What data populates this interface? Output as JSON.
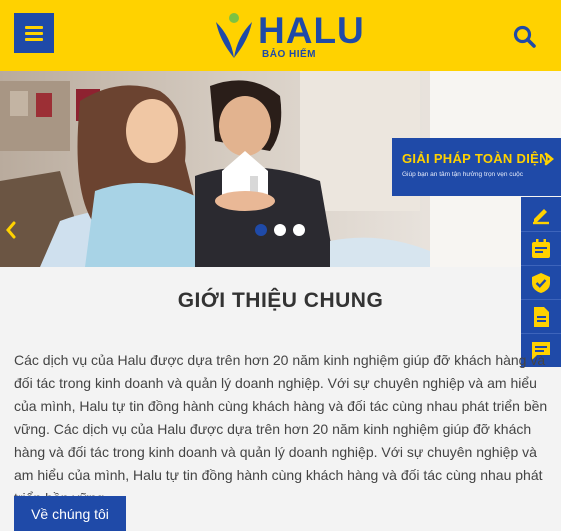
{
  "header": {
    "logo_text": "HALU",
    "logo_sub": "BẢO HIỂM",
    "menu_icon": "hamburger-menu-icon",
    "search_icon": "search-icon",
    "bg_color": "#ffd200",
    "brand_color": "#1f4aa8"
  },
  "hero": {
    "slides_total": 3,
    "active_slide": 1,
    "banner": {
      "title": "GIẢI PHÁP TOÀN DIỆN",
      "subtitle": "Giúp bạn an tâm tận hưởng trọn vẹn cuộc"
    }
  },
  "side_tools": [
    {
      "icon": "edit-document-icon"
    },
    {
      "icon": "calendar-icon"
    },
    {
      "icon": "shield-check-icon"
    },
    {
      "icon": "document-icon"
    },
    {
      "icon": "chat-icon"
    }
  ],
  "intro": {
    "title": "GIỚI THIỆU CHUNG",
    "body": "Các dịch vụ của Halu được dựa trên hơn 20 năm kinh nghiệm giúp đỡ khách hàng và đối tác trong kinh doanh và quản lý doanh nghiệp. Với sự chuyên nghiệp và am hiểu của mình, Halu tự tin đồng hành cùng khách hàng và đối tác cùng nhau phát triển bền vững. Các dịch vụ của Halu được dựa trên hơn 20 năm kinh nghiệm giúp đỡ khách hàng và đối tác trong kinh doanh và quản lý doanh nghiệp. Với sự chuyên nghiệp và am hiểu của mình, Halu tự tin đồng hành cùng khách hàng và đối tác cùng nhau phát triển bền vững.",
    "button_label": "Về chúng tôi"
  }
}
